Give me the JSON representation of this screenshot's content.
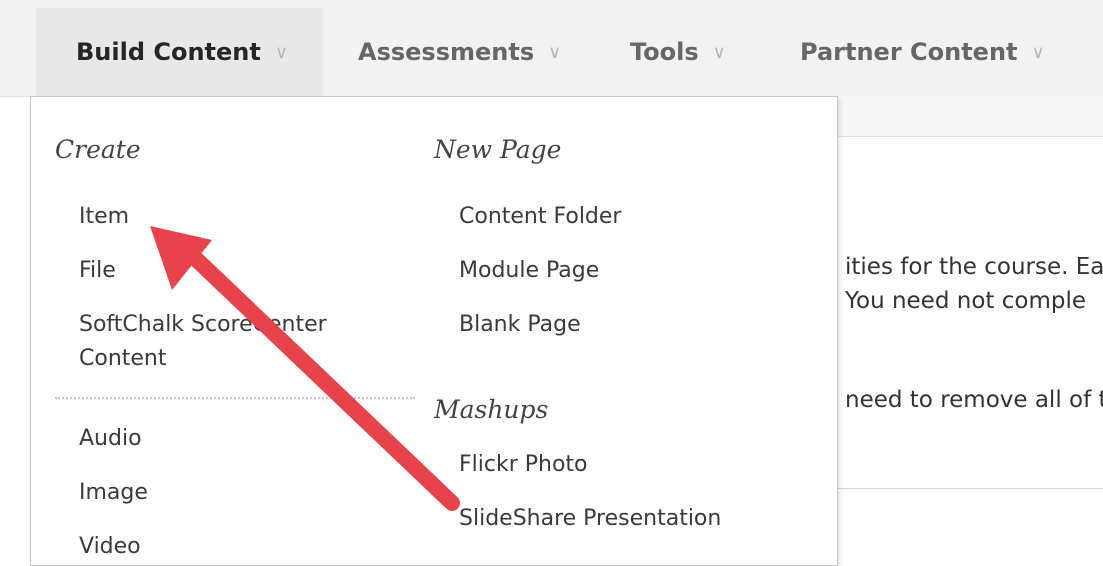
{
  "nav": {
    "tabs": [
      {
        "label": "Build Content",
        "active": true
      },
      {
        "label": "Assessments",
        "active": false
      },
      {
        "label": "Tools",
        "active": false
      },
      {
        "label": "Partner Content",
        "active": false
      }
    ],
    "chevron": "∨"
  },
  "menu": {
    "create_heading": "Create",
    "create_items": [
      "Item",
      "File",
      "SoftChalk ScoreCenter Content"
    ],
    "media_items": [
      "Audio",
      "Image",
      "Video"
    ],
    "newpage_heading": "New Page",
    "newpage_items": [
      "Content Folder",
      "Module Page",
      "Blank Page"
    ],
    "mashups_heading": "Mashups",
    "mashups_items": [
      "Flickr Photo",
      "SlideShare Presentation"
    ]
  },
  "background_text": {
    "line1": "ities for the course. Ea",
    "line2": "You need not comple",
    "line3": "need to remove all of t"
  },
  "colors": {
    "arrow": "#e8424b",
    "active_tab_bg": "#e8e8e8",
    "topbar_bg": "#f2f2f2"
  },
  "annotation": {
    "type": "arrow-pointing-to-item"
  }
}
